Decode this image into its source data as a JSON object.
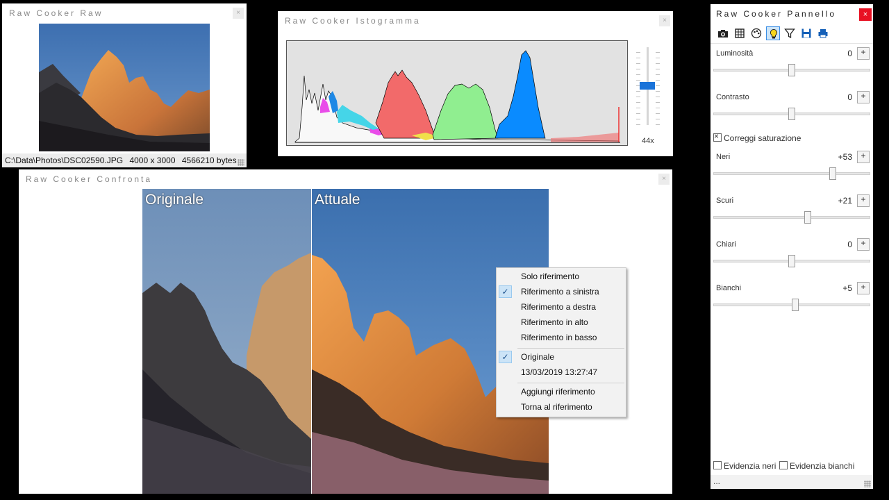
{
  "raw_window": {
    "title": "Raw Cooker Raw",
    "close_glyph": "×",
    "status": {
      "path": "C:\\Data\\Photos\\DSC02590.JPG",
      "dimensions": "4000 x 3000",
      "size": "4566210 bytes"
    }
  },
  "histogram_window": {
    "title": "Raw Cooker Istogramma",
    "close_glyph": "×",
    "zoom_label": "44x",
    "zoom_level": 0.55
  },
  "compare_window": {
    "title": "Raw Cooker Confronta",
    "close_glyph": "×",
    "left_label": "Originale",
    "right_label": "Attuale"
  },
  "context_menu": {
    "group1": [
      {
        "label": "Solo riferimento",
        "checked": false
      },
      {
        "label": "Riferimento a sinistra",
        "checked": true
      },
      {
        "label": "Riferimento a destra",
        "checked": false
      },
      {
        "label": "Riferimento in alto",
        "checked": false
      },
      {
        "label": "Riferimento in basso",
        "checked": false
      }
    ],
    "group2": [
      {
        "label": "Originale",
        "checked": true
      },
      {
        "label": "13/03/2019 13:27:47",
        "checked": false
      }
    ],
    "group3": [
      {
        "label": "Aggiungi riferimento",
        "checked": false
      },
      {
        "label": "Torna al riferimento",
        "checked": false
      }
    ],
    "check_glyph": "✓"
  },
  "panel": {
    "title": "Raw Cooker Pannello",
    "close_glyph": "×",
    "toolbar": [
      "camera-icon",
      "grid-icon",
      "palette-icon",
      "lightbulb-icon",
      "filter-icon",
      "save-icon",
      "print-icon"
    ],
    "active_tool": "lightbulb-icon",
    "sliders_top": [
      {
        "label": "Luminosità",
        "value": "0",
        "position": 0.5
      },
      {
        "label": "Contrasto",
        "value": "0",
        "position": 0.5
      }
    ],
    "saturation_checkbox": {
      "label": "Correggi saturazione",
      "checked": true
    },
    "sliders_bottom": [
      {
        "label": "Neri",
        "value": "+53",
        "position": 0.76
      },
      {
        "label": "Scuri",
        "value": "+21",
        "position": 0.6
      },
      {
        "label": "Chiari",
        "value": "0",
        "position": 0.5
      },
      {
        "label": "Bianchi",
        "value": "+5",
        "position": 0.52
      }
    ],
    "bottom_checkboxes": [
      {
        "label": "Evidenzia neri",
        "checked": false
      },
      {
        "label": "Evidenzia bianchi",
        "checked": false
      }
    ],
    "status_text": "..."
  },
  "colors": {
    "accent_blue": "#1a73d9",
    "close_red": "#e81123",
    "hist_red": "#f26a6a",
    "hist_green": "#90ee90",
    "hist_blue": "#0a8bff",
    "hist_cyan": "#45d5e8",
    "hist_magenta": "#e94ce9"
  }
}
